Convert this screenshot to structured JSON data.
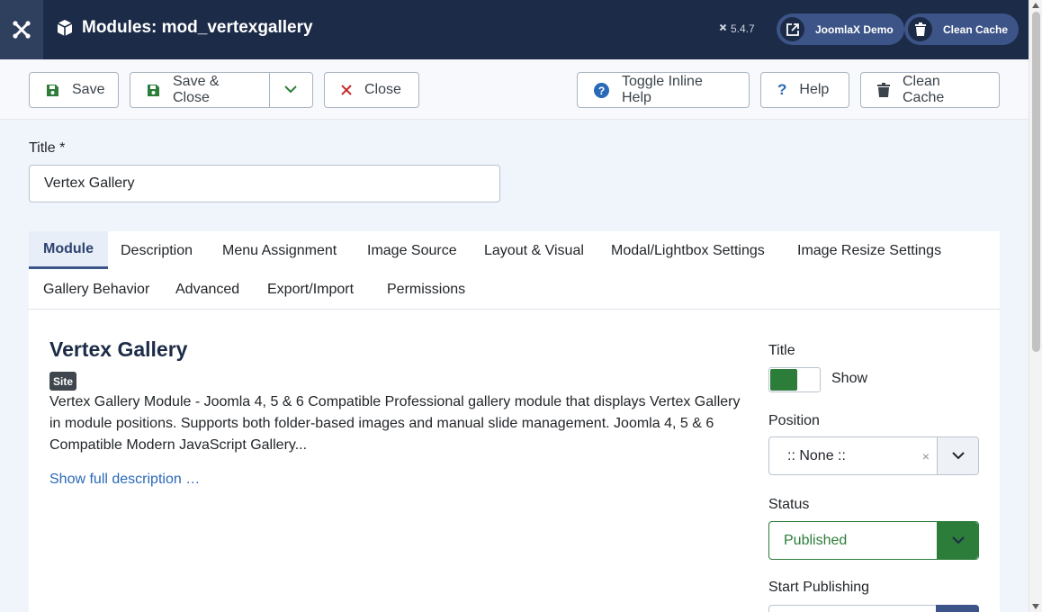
{
  "header": {
    "title": "Modules: mod_vertexgallery",
    "version": "5.4.7",
    "site_link_label": "JoomlaX Demo",
    "cache_button_label": "Clean Cache"
  },
  "toolbar": {
    "save_label": "Save",
    "save_close_label": "Save & Close",
    "close_label": "Close",
    "toggle_help_label": "Toggle Inline Help",
    "help_label": "Help",
    "clean_cache_label": "Clean Cache"
  },
  "form": {
    "title_label": "Title *",
    "title_value": "Vertex Gallery"
  },
  "tabs": [
    {
      "label": "Module",
      "active": true
    },
    {
      "label": "Description"
    },
    {
      "label": "Menu Assignment"
    },
    {
      "label": "Image Source"
    },
    {
      "label": "Layout & Visual"
    },
    {
      "label": "Modal/Lightbox Settings"
    },
    {
      "label": "Image Resize Settings"
    },
    {
      "label": "Gallery Behavior"
    },
    {
      "label": "Advanced"
    },
    {
      "label": "Export/Import"
    },
    {
      "label": "Permissions"
    }
  ],
  "module": {
    "name": "Vertex Gallery",
    "client_badge": "Site",
    "description": "Vertex Gallery Module - Joomla 4, 5 & 6 Compatible Professional gallery module that displays Vertex Gallery in module positions. Supports both folder-based images and manual slide management. Joomla 4, 5 & 6 Compatible Modern JavaScript Gallery...",
    "show_full_link": "Show full description …"
  },
  "options": {
    "title_label": "Title",
    "title_toggle_text": "Show",
    "position_label": "Position",
    "position_value": ":: None ::",
    "position_clear": "×",
    "status_label": "Status",
    "status_value": "Published",
    "start_publishing_label": "Start Publishing"
  },
  "colors": {
    "header_bg": "#1c2b47",
    "accent": "#3c5487",
    "published_green": "#2c7c3a",
    "link_blue": "#2a69b8",
    "close_red": "#c52827"
  }
}
